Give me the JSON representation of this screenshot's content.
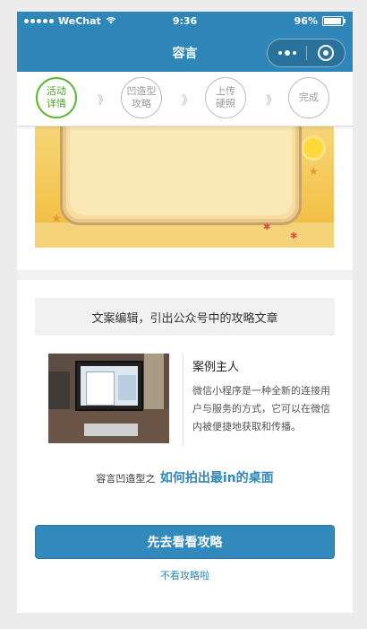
{
  "status_bar": {
    "carrier": "WeChat",
    "time": "9:36",
    "battery": "96%",
    "battery_level": 0.96
  },
  "navbar": {
    "title": "容言",
    "more_icon": "more-dots-icon",
    "close_icon": "target-circle-icon"
  },
  "steps": [
    {
      "label_line1": "活动",
      "label_line2": "详情",
      "active": true
    },
    {
      "label_line1": "凹造型",
      "label_line2": "攻略",
      "active": false
    },
    {
      "label_line1": "上传",
      "label_line2": "硬照",
      "active": false
    },
    {
      "label_line1": "完成",
      "label_line2": "",
      "active": false
    }
  ],
  "step_separator": "》",
  "banner": {
    "text": "文案编辑，引出公众号中的攻略文章"
  },
  "case": {
    "title": "案例主人",
    "description": "微信小程序是一种全新的连接用户与服务的方式，它可以在微信内被便捷地获取和传播。"
  },
  "subline": {
    "prefix": "容言凹造型之",
    "highlight": "如何拍出最in的桌面"
  },
  "actions": {
    "primary": "先去看看攻略",
    "secondary": "不看攻略啦"
  },
  "colors": {
    "brand": "#2f86b8",
    "active_step": "#5bb82f"
  }
}
